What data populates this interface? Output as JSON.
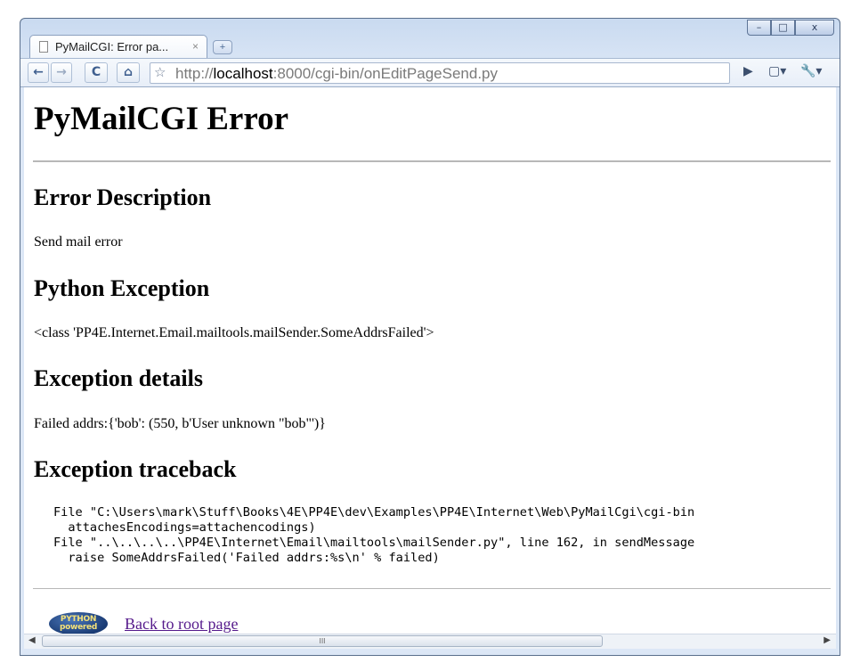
{
  "window": {
    "controls": {
      "minimize": "–",
      "maximize": "□",
      "close": "x"
    }
  },
  "tab": {
    "title": "PyMailCGI: Error pa...",
    "close": "×",
    "new_tab": "+"
  },
  "toolbar": {
    "back": "←",
    "forward": "→",
    "reload": "C",
    "home": "⌂",
    "bookmark": "☆",
    "url_prefix": "http://",
    "url_host": "localhost",
    "url_rest": ":8000/cgi-bin/onEditPageSend.py",
    "play": "▶",
    "page_menu": "▢▾",
    "wrench_menu": "🔧▾"
  },
  "page": {
    "title": "PyMailCGI Error",
    "sections": [
      {
        "heading": "Error Description",
        "text": "Send mail error"
      },
      {
        "heading": "Python Exception",
        "text": "<class 'PP4E.Internet.Email.mailtools.mailSender.SomeAddrsFailed'>"
      },
      {
        "heading": "Exception details",
        "text": "Failed addrs:{'bob': (550, b'User unknown \"bob\"')}"
      },
      {
        "heading": "Exception traceback",
        "text": ""
      }
    ],
    "traceback": "File \"C:\\Users\\mark\\Stuff\\Books\\4E\\PP4E\\dev\\Examples\\PP4E\\Internet\\Web\\PyMailCgi\\cgi-bin\n  attachesEncodings=attachencodings)\nFile \"..\\..\\..\\..\\PP4E\\Internet\\Email\\mailtools\\mailSender.py\", line 162, in sendMessage\n  raise SomeAddrsFailed('Failed addrs:%s\\n' % failed)",
    "logo_text": "PYTHON powered",
    "back_link": "Back to root page"
  },
  "scrollbar": {
    "left": "◀",
    "right": "▶",
    "grip": "III"
  },
  "colors": {
    "link_visited": "#551a8b",
    "chrome_frame": "#c9daf0"
  }
}
